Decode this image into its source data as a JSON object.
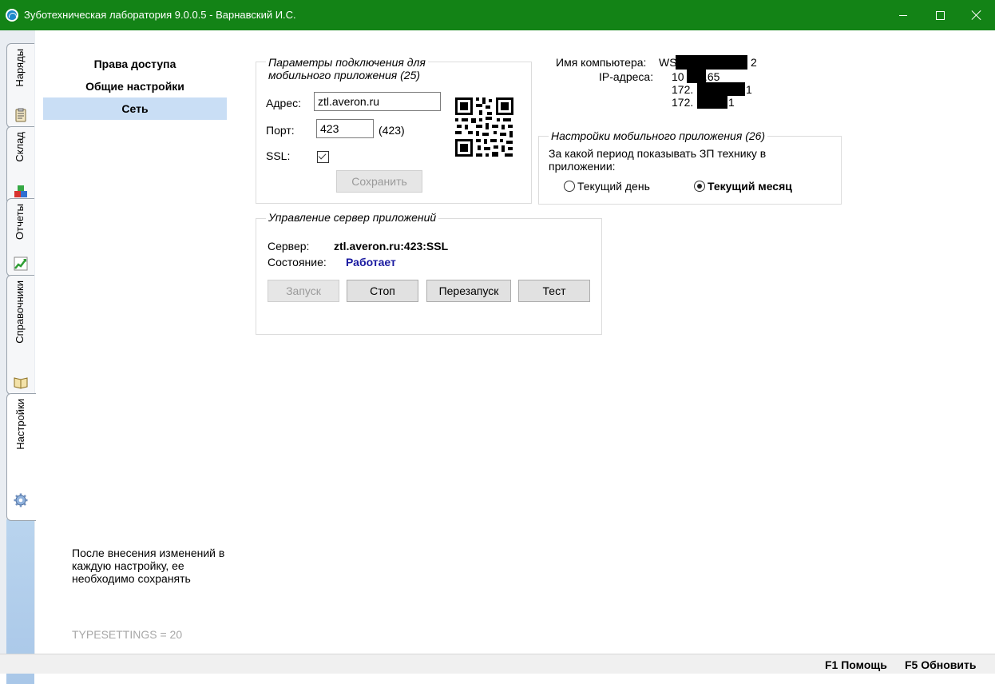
{
  "window": {
    "title": "Зуботехническая лаборатория 9.0.0.5 - Варнавский И.С."
  },
  "tabs": [
    {
      "label": "Наряды",
      "icon": "clipboard-icon"
    },
    {
      "label": "Склад",
      "icon": "boxes-icon"
    },
    {
      "label": "Отчеты",
      "icon": "chart-icon"
    },
    {
      "label": "Справочники",
      "icon": "book-icon"
    },
    {
      "label": "Настройки",
      "icon": "gear-icon",
      "active": true
    }
  ],
  "nav": {
    "items": [
      {
        "label": "Права доступа"
      },
      {
        "label": "Общие настройки"
      },
      {
        "label": "Сеть",
        "selected": true
      }
    ],
    "hint": "После внесения изменений в каждую настройку, ее необходимо сохранять",
    "typesettings": "TYPESETTINGS = 20"
  },
  "mobile_connection": {
    "legend_line1": "Параметры подключения для",
    "legend_line2": "мобильного приложения (25)",
    "address_label": "Адрес:",
    "address_value": "ztl.averon.ru",
    "port_label": "Порт:",
    "port_value": "423",
    "port_default": "(423)",
    "ssl_label": "SSL:",
    "ssl_checked": true,
    "save_label": "Сохранить"
  },
  "computer_info": {
    "name_label": "Имя компьютера:",
    "name_prefix": "WS",
    "name_suffix": "2",
    "ip_label": "IP-адреса:",
    "ip1_prefix": "10",
    "ip1_suffix": ".65",
    "ip2_prefix": "172.",
    "ip2_suffix": "1",
    "ip3_prefix": "172.",
    "ip3_suffix": "1"
  },
  "mobile_settings": {
    "legend": "Настройки мобильного приложения (26)",
    "question_line1": "За какой период показывать ЗП технику в",
    "question_line2": "приложении:",
    "option_day": "Текущий день",
    "option_month": "Текущий месяц",
    "selected": "month"
  },
  "server": {
    "legend": "Управление сервер приложений",
    "server_label": "Сервер:",
    "server_value": "ztl.averon.ru:423:SSL",
    "state_label": "Состояние:",
    "state_value": "Работает",
    "state_color": "#1a1aa0",
    "btn_start": "Запуск",
    "btn_stop": "Стоп",
    "btn_restart": "Перезапуск",
    "btn_test": "Тест"
  },
  "statusbar": {
    "help": "F1 Помощь",
    "refresh": "F5 Обновить"
  },
  "colors": {
    "titlebar": "#138316",
    "nav_selected": "#c9def5"
  }
}
